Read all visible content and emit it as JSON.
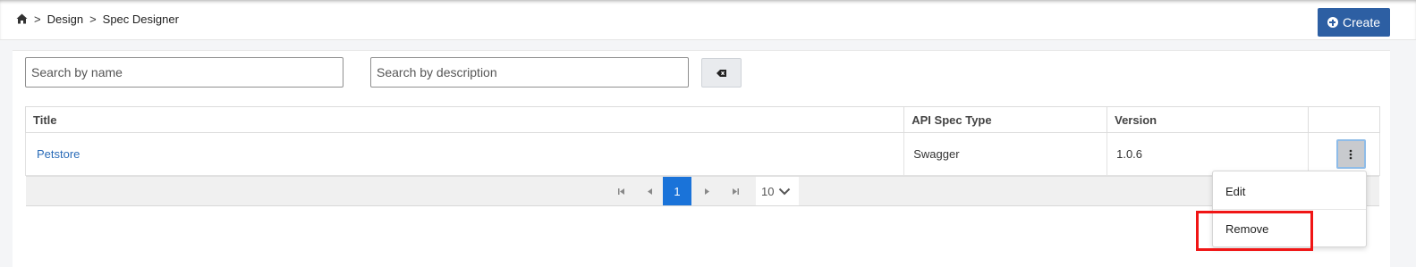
{
  "breadcrumb": {
    "home_icon": "home-icon",
    "separator": ">",
    "items": [
      "Design",
      "Spec Designer"
    ]
  },
  "create_button": {
    "label": "Create",
    "icon": "plus-circle-icon",
    "color": "#2d5fa3"
  },
  "filters": {
    "name_placeholder": "Search by name",
    "name_value": "",
    "description_placeholder": "Search by description",
    "description_value": "",
    "clear_icon": "eraser-icon"
  },
  "table": {
    "columns": [
      "Title",
      "API Spec Type",
      "Version",
      ""
    ],
    "rows": [
      {
        "title": "Petstore",
        "type": "Swagger",
        "version": "1.0.6",
        "actions_icon": "kebab-vertical-icon"
      }
    ]
  },
  "pager": {
    "current_page": "1",
    "page_size": "10",
    "accent": "#1a73d9"
  },
  "action_menu": {
    "items": [
      "Edit",
      "Remove"
    ],
    "highlighted": "Remove",
    "highlight_color": "#f01515"
  }
}
